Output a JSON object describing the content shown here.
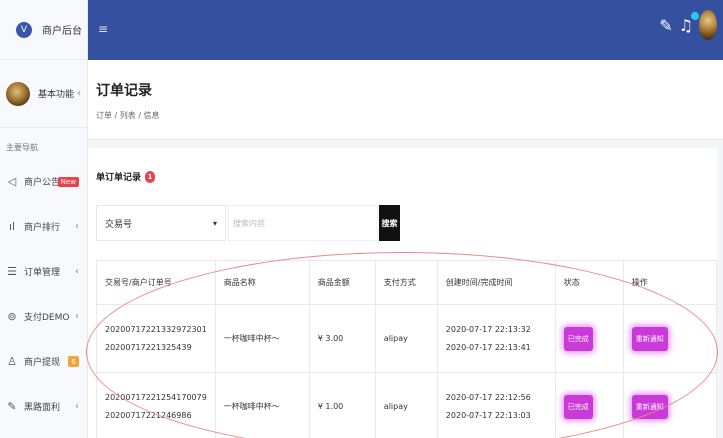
{
  "brand": {
    "logo": "V",
    "title": "商户后台"
  },
  "user": {
    "label": "基本功能"
  },
  "sidebar": {
    "section_label": "主要导航",
    "items": [
      {
        "icon": "megaphone-icon",
        "glyph": "◁",
        "label": "商户公告",
        "badge": "New"
      },
      {
        "icon": "bar-chart-icon",
        "glyph": "╻",
        "label": "商户排行"
      },
      {
        "icon": "list-icon",
        "glyph": "☰",
        "label": "订单管理"
      },
      {
        "icon": "pay-icon",
        "glyph": "⊚",
        "label": "支付DEMO"
      },
      {
        "icon": "user-icon",
        "glyph": "♙",
        "label": "商户提现",
        "badge": "6"
      },
      {
        "icon": "edit-icon",
        "glyph": "✎",
        "label": "黑路面利"
      }
    ]
  },
  "header": {
    "menu_icon": "≡"
  },
  "page": {
    "title": "订单记录",
    "breadcrumb": "订单 / 列表 / 信息"
  },
  "card": {
    "title": "单订单记录",
    "count": "1"
  },
  "filter": {
    "selected": "交易号",
    "caret": "▾"
  },
  "search": {
    "placeholder": "搜索内容",
    "button": "搜索"
  },
  "table": {
    "headers": [
      "交易号/商户订单号",
      "商品名称",
      "商品金额",
      "支付方式",
      "创建时间/完成时间",
      "状态",
      "操作"
    ],
    "rows": [
      {
        "trade_no": "20200717221332972301",
        "order_no": "20200717221325439",
        "product": "一杯咖啡中杯～",
        "amount": "¥ 3.00",
        "method": "alipay",
        "created": "2020-07-17 22:13:32",
        "completed": "2020-07-17 22:13:41",
        "status": "已完成",
        "action": "重新通知"
      },
      {
        "trade_no": "20200717221254170079",
        "order_no": "20200717221246986",
        "product": "一杯咖啡中杯～",
        "amount": "¥ 1.00",
        "method": "alipay",
        "created": "2020-07-17 22:12:56",
        "completed": "2020-07-17 22:13:03",
        "status": "已完成",
        "action": "重新通知"
      }
    ]
  },
  "colors": {
    "topbar": "#34509e",
    "accent_chip": "#c93ad9",
    "badge_red": "#e8434b",
    "badge_orange": "#f2a33a"
  }
}
